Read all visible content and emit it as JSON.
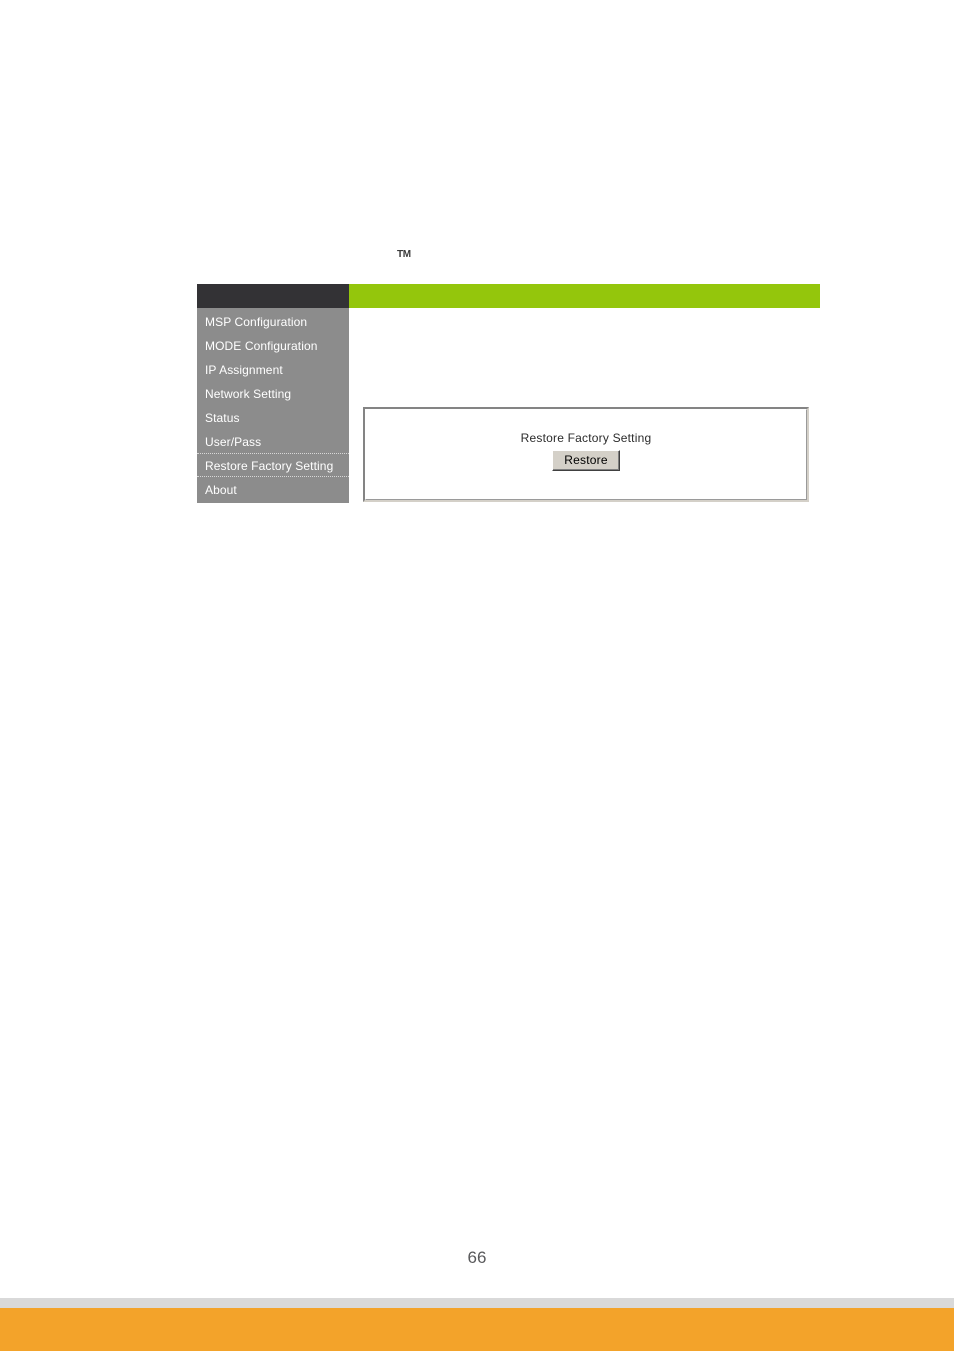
{
  "page": {
    "number": "66",
    "trademark_mark": "TM"
  },
  "embedded_ui": {
    "header": {
      "brand_color": "#333235",
      "accent_color": "#94c60c"
    },
    "sidebar": {
      "background_color": "#8c8c8c",
      "text_color": "#ffffff",
      "selected_index": 6,
      "items": [
        {
          "label": "MSP Configuration"
        },
        {
          "label": "MODE Configuration"
        },
        {
          "label": "IP Assignment"
        },
        {
          "label": "Network Setting"
        },
        {
          "label": "Status"
        },
        {
          "label": "User/Pass"
        },
        {
          "label": "Restore Factory Setting"
        },
        {
          "label": "About"
        }
      ]
    },
    "content": {
      "panel": {
        "label": "Restore Factory Setting",
        "button_label": "Restore"
      }
    }
  },
  "footer": {
    "divider_color": "#d9d9d9",
    "band_color": "#f3a32a"
  }
}
